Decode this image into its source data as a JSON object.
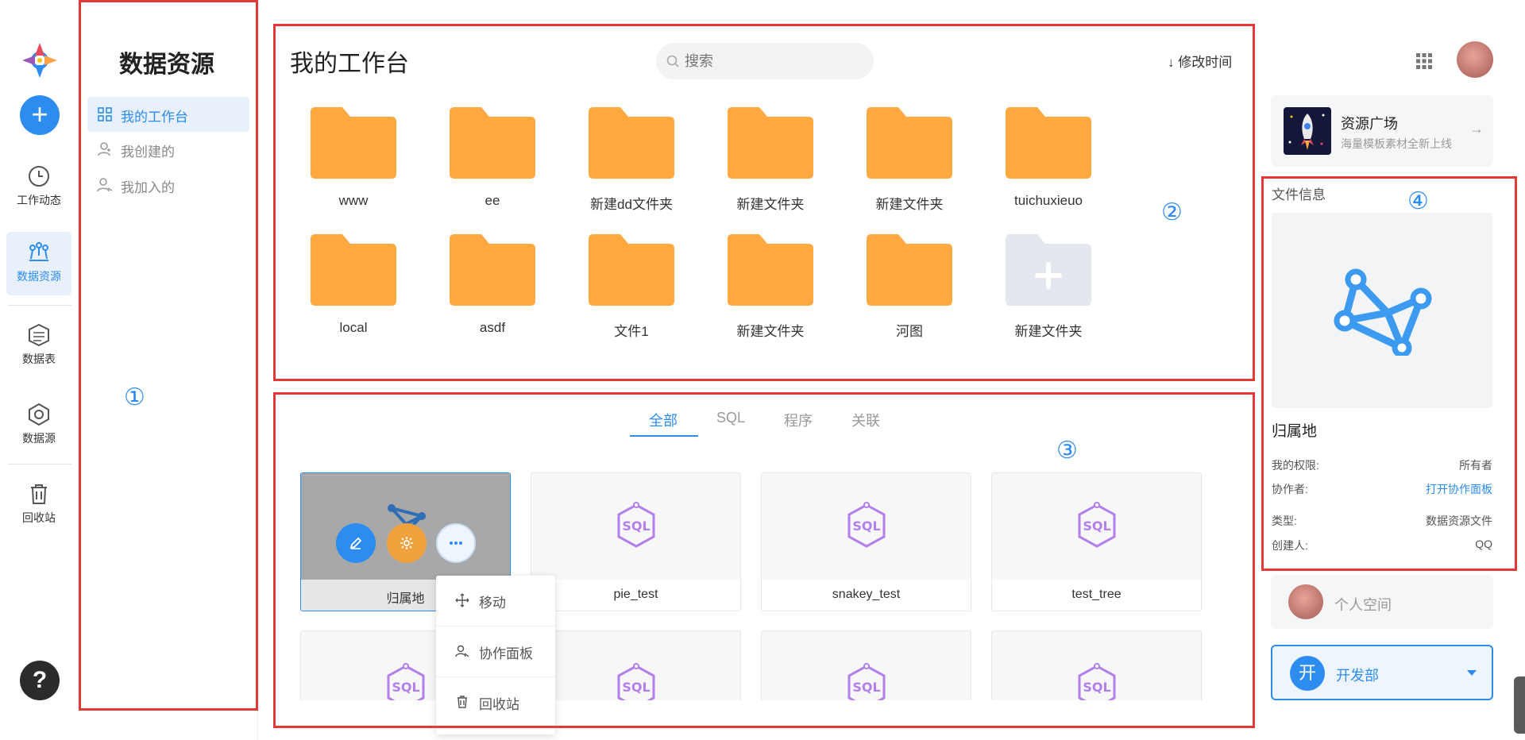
{
  "rail": {
    "items": [
      {
        "label": "工作动态"
      },
      {
        "label": "数据资源"
      },
      {
        "label": "数据表"
      },
      {
        "label": "数据源"
      },
      {
        "label": "回收站"
      }
    ],
    "add_label": "+",
    "help_label": "?"
  },
  "annotations": [
    "①",
    "②",
    "③",
    "④"
  ],
  "sidebar": {
    "title": "数据资源",
    "items": [
      {
        "label": "我的工作台"
      },
      {
        "label": "我创建的"
      },
      {
        "label": "我加入的"
      }
    ]
  },
  "workspace": {
    "title": "我的工作台",
    "search_placeholder": "搜索",
    "sort_label": "修改时间",
    "sort_arrow": "↓",
    "folders": [
      {
        "name": "www"
      },
      {
        "name": "ee"
      },
      {
        "name": "新建dd文件夹"
      },
      {
        "name": "新建文件夹"
      },
      {
        "name": "新建文件夹"
      },
      {
        "name": "tuichuxieuo"
      },
      {
        "name": "local"
      },
      {
        "name": "asdf"
      },
      {
        "name": "文件1"
      },
      {
        "name": "新建文件夹"
      },
      {
        "name": "河图"
      },
      {
        "name": "新建文件夹"
      }
    ]
  },
  "files": {
    "tabs": [
      {
        "label": "全部"
      },
      {
        "label": "SQL"
      },
      {
        "label": "程序"
      },
      {
        "label": "关联"
      }
    ],
    "cards": [
      {
        "name": "归属地"
      },
      {
        "name": "pie_test"
      },
      {
        "name": "snakey_test"
      },
      {
        "name": "test_tree"
      }
    ],
    "context_menu": [
      {
        "label": "移动"
      },
      {
        "label": "协作面板"
      },
      {
        "label": "回收站"
      }
    ]
  },
  "right": {
    "promo": {
      "title": "资源广场",
      "subtitle": "海量模板素材全新上线",
      "arrow": "→"
    },
    "file_info": {
      "title": "文件信息",
      "name": "归属地",
      "rows": [
        {
          "key": "我的权限:",
          "value": "所有者"
        },
        {
          "key": "协作者:",
          "value": "打开协作面板"
        },
        {
          "key": "类型:",
          "value": "数据资源文件"
        },
        {
          "key": "创建人:",
          "value": "QQ"
        }
      ]
    },
    "space": {
      "label": "个人空间"
    },
    "team": {
      "avatar_text": "开",
      "name": "开发部"
    }
  },
  "colors": {
    "accent": "#2d8cf0",
    "folder": "#ffa940",
    "folder_new": "#e4e7ee",
    "sql_icon": "#b37feb",
    "annotation_box": "#e53935",
    "edit_button": "#2d8cf0",
    "settings_button": "#f0a13c"
  }
}
